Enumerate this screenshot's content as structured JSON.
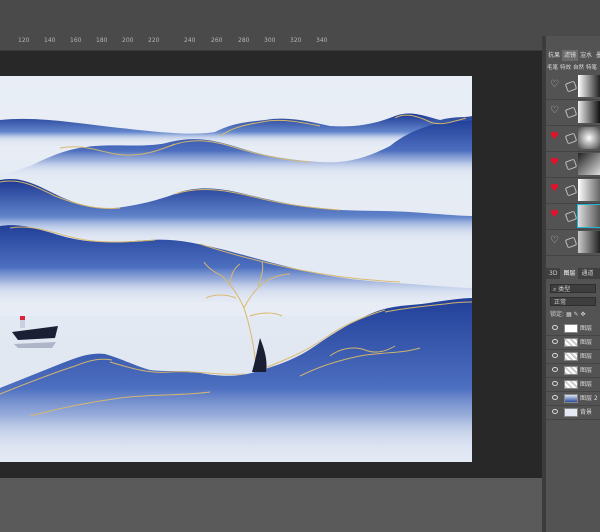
{
  "ruler": {
    "ticks": [
      "120",
      "140",
      "160",
      "180",
      "200",
      "220",
      "240",
      "260",
      "280",
      "300",
      "320",
      "340"
    ]
  },
  "panel": {
    "tabs": [
      "抗果",
      "滤镜",
      "渲水",
      "墨脂"
    ],
    "subtabs": [
      "毛笔",
      "特效",
      "自然",
      "特笔"
    ],
    "styles": [
      {
        "favorite": false
      },
      {
        "favorite": false
      },
      {
        "favorite": true
      },
      {
        "favorite": true
      },
      {
        "favorite": true
      },
      {
        "favorite": true
      },
      {
        "favorite": false
      }
    ],
    "layers_tabs": [
      "3D",
      "图层",
      "通道"
    ],
    "filter_label": "类型",
    "blend_mode": "正常",
    "lock_label": "锁定:",
    "layers": [
      {
        "name": "图层"
      },
      {
        "name": "图层"
      },
      {
        "name": "图层"
      },
      {
        "name": "图层"
      },
      {
        "name": "图层"
      },
      {
        "name": "图层 2"
      },
      {
        "name": "背景"
      }
    ]
  },
  "colors": {
    "accent_heart": "#e8102a",
    "selection": "#1fb4d6",
    "gold": "#d9b96a",
    "ink_blue": "#1e3a8a"
  }
}
